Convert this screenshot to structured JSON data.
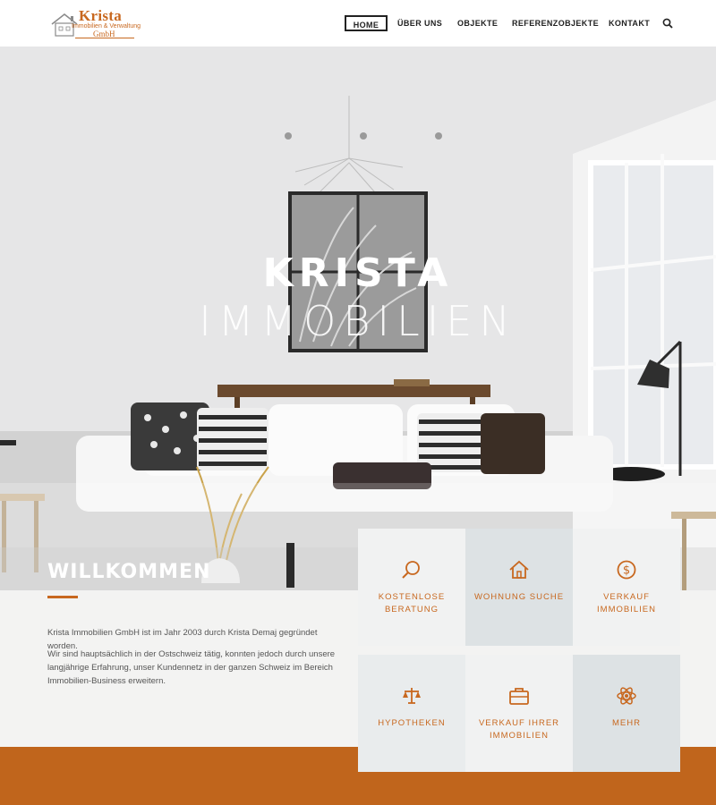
{
  "brand": {
    "name": "Krista",
    "subtitle": "Immobilien & Verwaltung",
    "suffix": "GmbH",
    "accent_color": "#c8681f"
  },
  "nav": {
    "items": [
      {
        "label": "HOME",
        "active": true
      },
      {
        "label": "ÜBER UNS"
      },
      {
        "label": "OBJEKTE"
      },
      {
        "label": "REFERENZOBJEKTE"
      },
      {
        "label": "KONTAKT"
      }
    ],
    "search_icon": "search-icon"
  },
  "hero": {
    "title": "KRISTA",
    "subtitle": "IMMOBILIEN"
  },
  "intro": {
    "title": "WILLKOMMEN",
    "paragraphs": [
      "Krista Immobilien GmbH ist im Jahr 2003 durch Krista Demaj gegründet worden.",
      "Wir sind hauptsächlich in der Ostschweiz tätig, konnten jedoch durch unsere langjährige Erfahrung, unser Kundennetz in der ganzen Schweiz im Bereich Immobilien-Business erweitern."
    ]
  },
  "services": [
    {
      "label": "KOSTENLOSE BERATUNG",
      "icon": "magnifier-icon"
    },
    {
      "label": "WOHNUNG SUCHE",
      "icon": "house-icon"
    },
    {
      "label": "VERKAUF IMMOBILIEN",
      "icon": "dollar-coin-icon"
    },
    {
      "label": "HYPOTHEKEN",
      "icon": "scales-icon"
    },
    {
      "label": "VERKAUF IHRER IMMOBILIEN",
      "icon": "briefcase-icon"
    },
    {
      "label": "MEHR",
      "icon": "atom-icon"
    }
  ],
  "footer": {
    "band_color": "#c0651c"
  }
}
